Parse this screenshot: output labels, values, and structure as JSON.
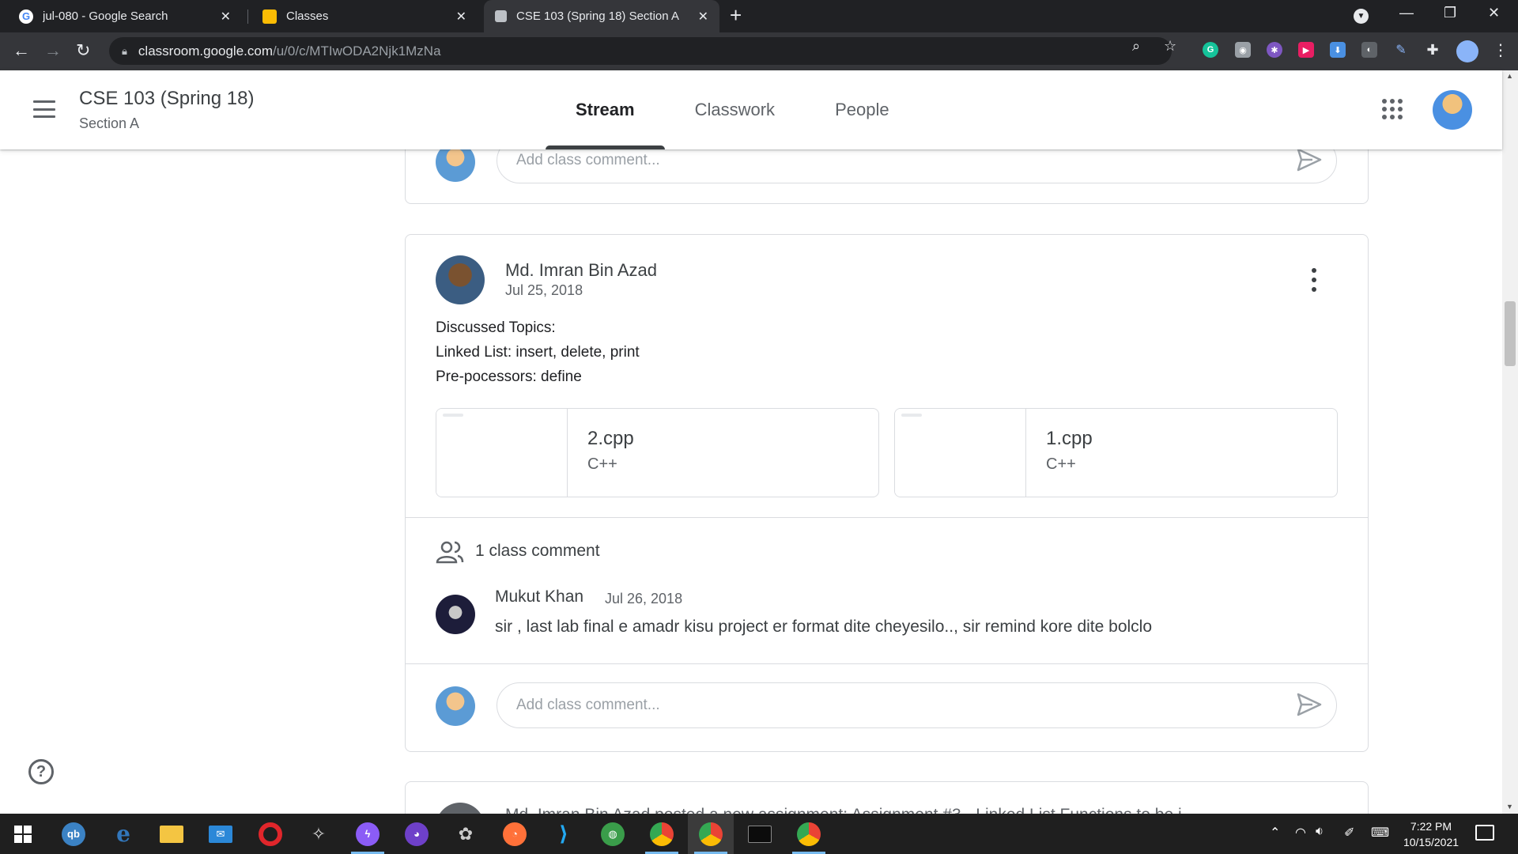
{
  "browser": {
    "tabs": [
      {
        "title": "jul-080 - Google Search",
        "favicon": "google-icon",
        "active": false
      },
      {
        "title": "Classes",
        "favicon": "classroom-icon",
        "active": false
      },
      {
        "title": "CSE 103 (Spring 18) Section A",
        "favicon": "classroom-icon",
        "active": true
      }
    ],
    "url_host": "classroom.google.com",
    "url_path": "/u/0/c/MTIwODA2Njk1MzNa"
  },
  "classroom": {
    "class_name": "CSE 103 (Spring 18)",
    "section": "Section A",
    "tabs": [
      "Stream",
      "Classwork",
      "People"
    ],
    "active_tab": "Stream"
  },
  "stream": {
    "comment_placeholder": "Add class comment...",
    "post": {
      "author": "Md. Imran Bin Azad",
      "date": "Jul 25, 2018",
      "body": [
        "Discussed Topics:",
        "Linked List: insert, delete, print",
        "Pre-pocessors: define"
      ],
      "attachments": [
        {
          "name": "2.cpp",
          "type": "C++"
        },
        {
          "name": "1.cpp",
          "type": "C++"
        }
      ],
      "comment_count": "1 class comment",
      "comments": [
        {
          "author": "Mukut Khan",
          "date": "Jul 26, 2018",
          "text": "sir , last lab final e amadr kisu project er format  dite cheyesilo.., sir remind kore dite bolclo"
        }
      ]
    },
    "next_post_peek": "Md. Imran Bin Azad posted a new assignment: Assignment #3 - Linked List Functions to be i"
  },
  "taskbar": {
    "time": "7:22 PM",
    "date": "10/15/2021"
  },
  "colors": {
    "chrome_dark": "#202124",
    "chrome_toolbar": "#35363a",
    "text_primary": "#3c4043",
    "text_secondary": "#5f6368",
    "border": "#dadce0"
  }
}
